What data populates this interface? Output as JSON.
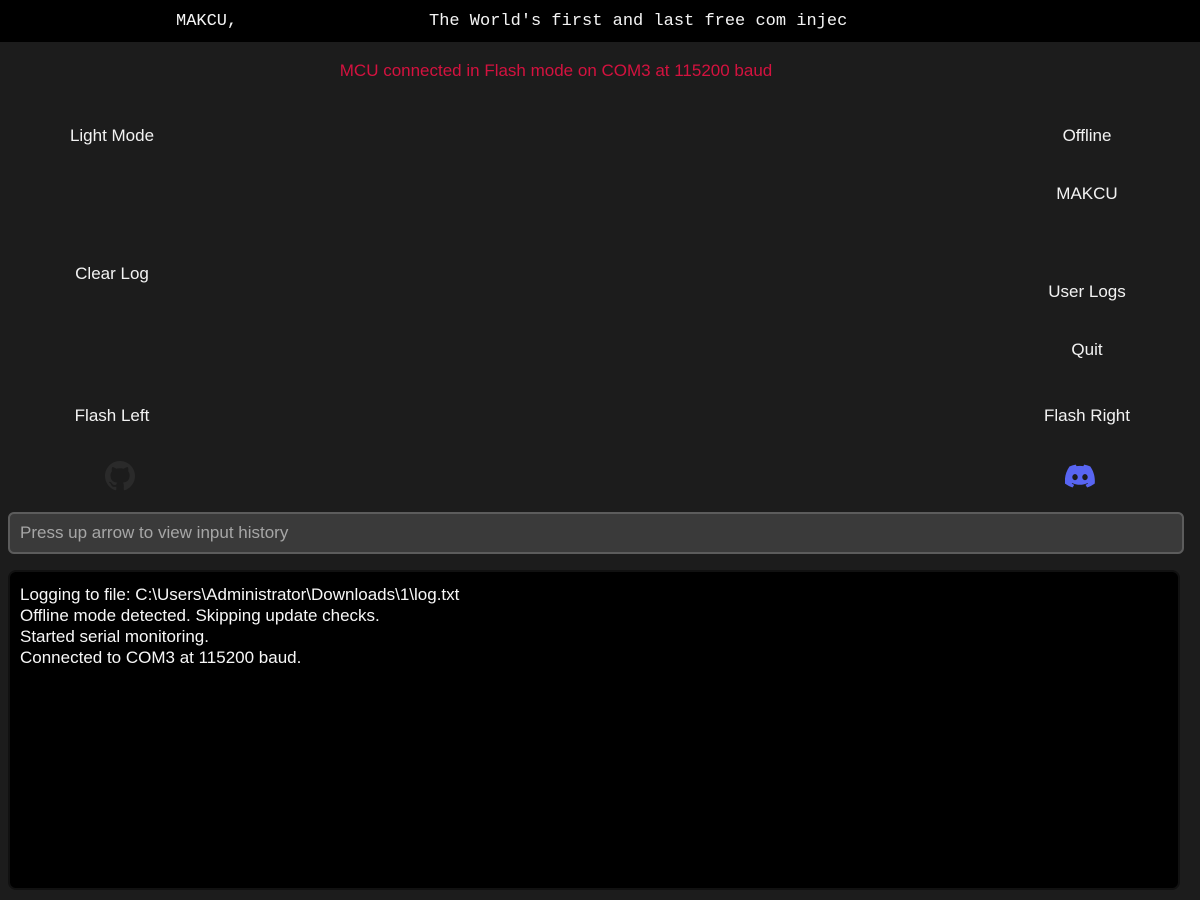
{
  "header": {
    "brand": "MAKCU,",
    "marquee": "The World's first and last free com injec"
  },
  "status": {
    "text": "MCU connected in Flash mode on COM3 at 115200 baud",
    "color": "#d4123f"
  },
  "buttons": {
    "light_mode": "Light Mode",
    "clear_log": "Clear Log",
    "flash_left": "Flash Left",
    "offline": "Offline",
    "makcu": "MAKCU",
    "user_logs": "User Logs",
    "quit": "Quit",
    "flash_right": "Flash Right"
  },
  "icons": {
    "github": {
      "name": "github-icon",
      "color": "#2a2a2a"
    },
    "discord": {
      "name": "discord-icon",
      "color": "#5865f2"
    }
  },
  "console": {
    "placeholder": "Press up arrow to view input history",
    "value": ""
  },
  "log": {
    "lines": [
      "Logging to file: C:\\Users\\Administrator\\Downloads\\1\\log.txt",
      "Offline mode detected. Skipping update checks.",
      "Started serial monitoring.",
      "Connected to COM3 at 115200 baud."
    ]
  }
}
